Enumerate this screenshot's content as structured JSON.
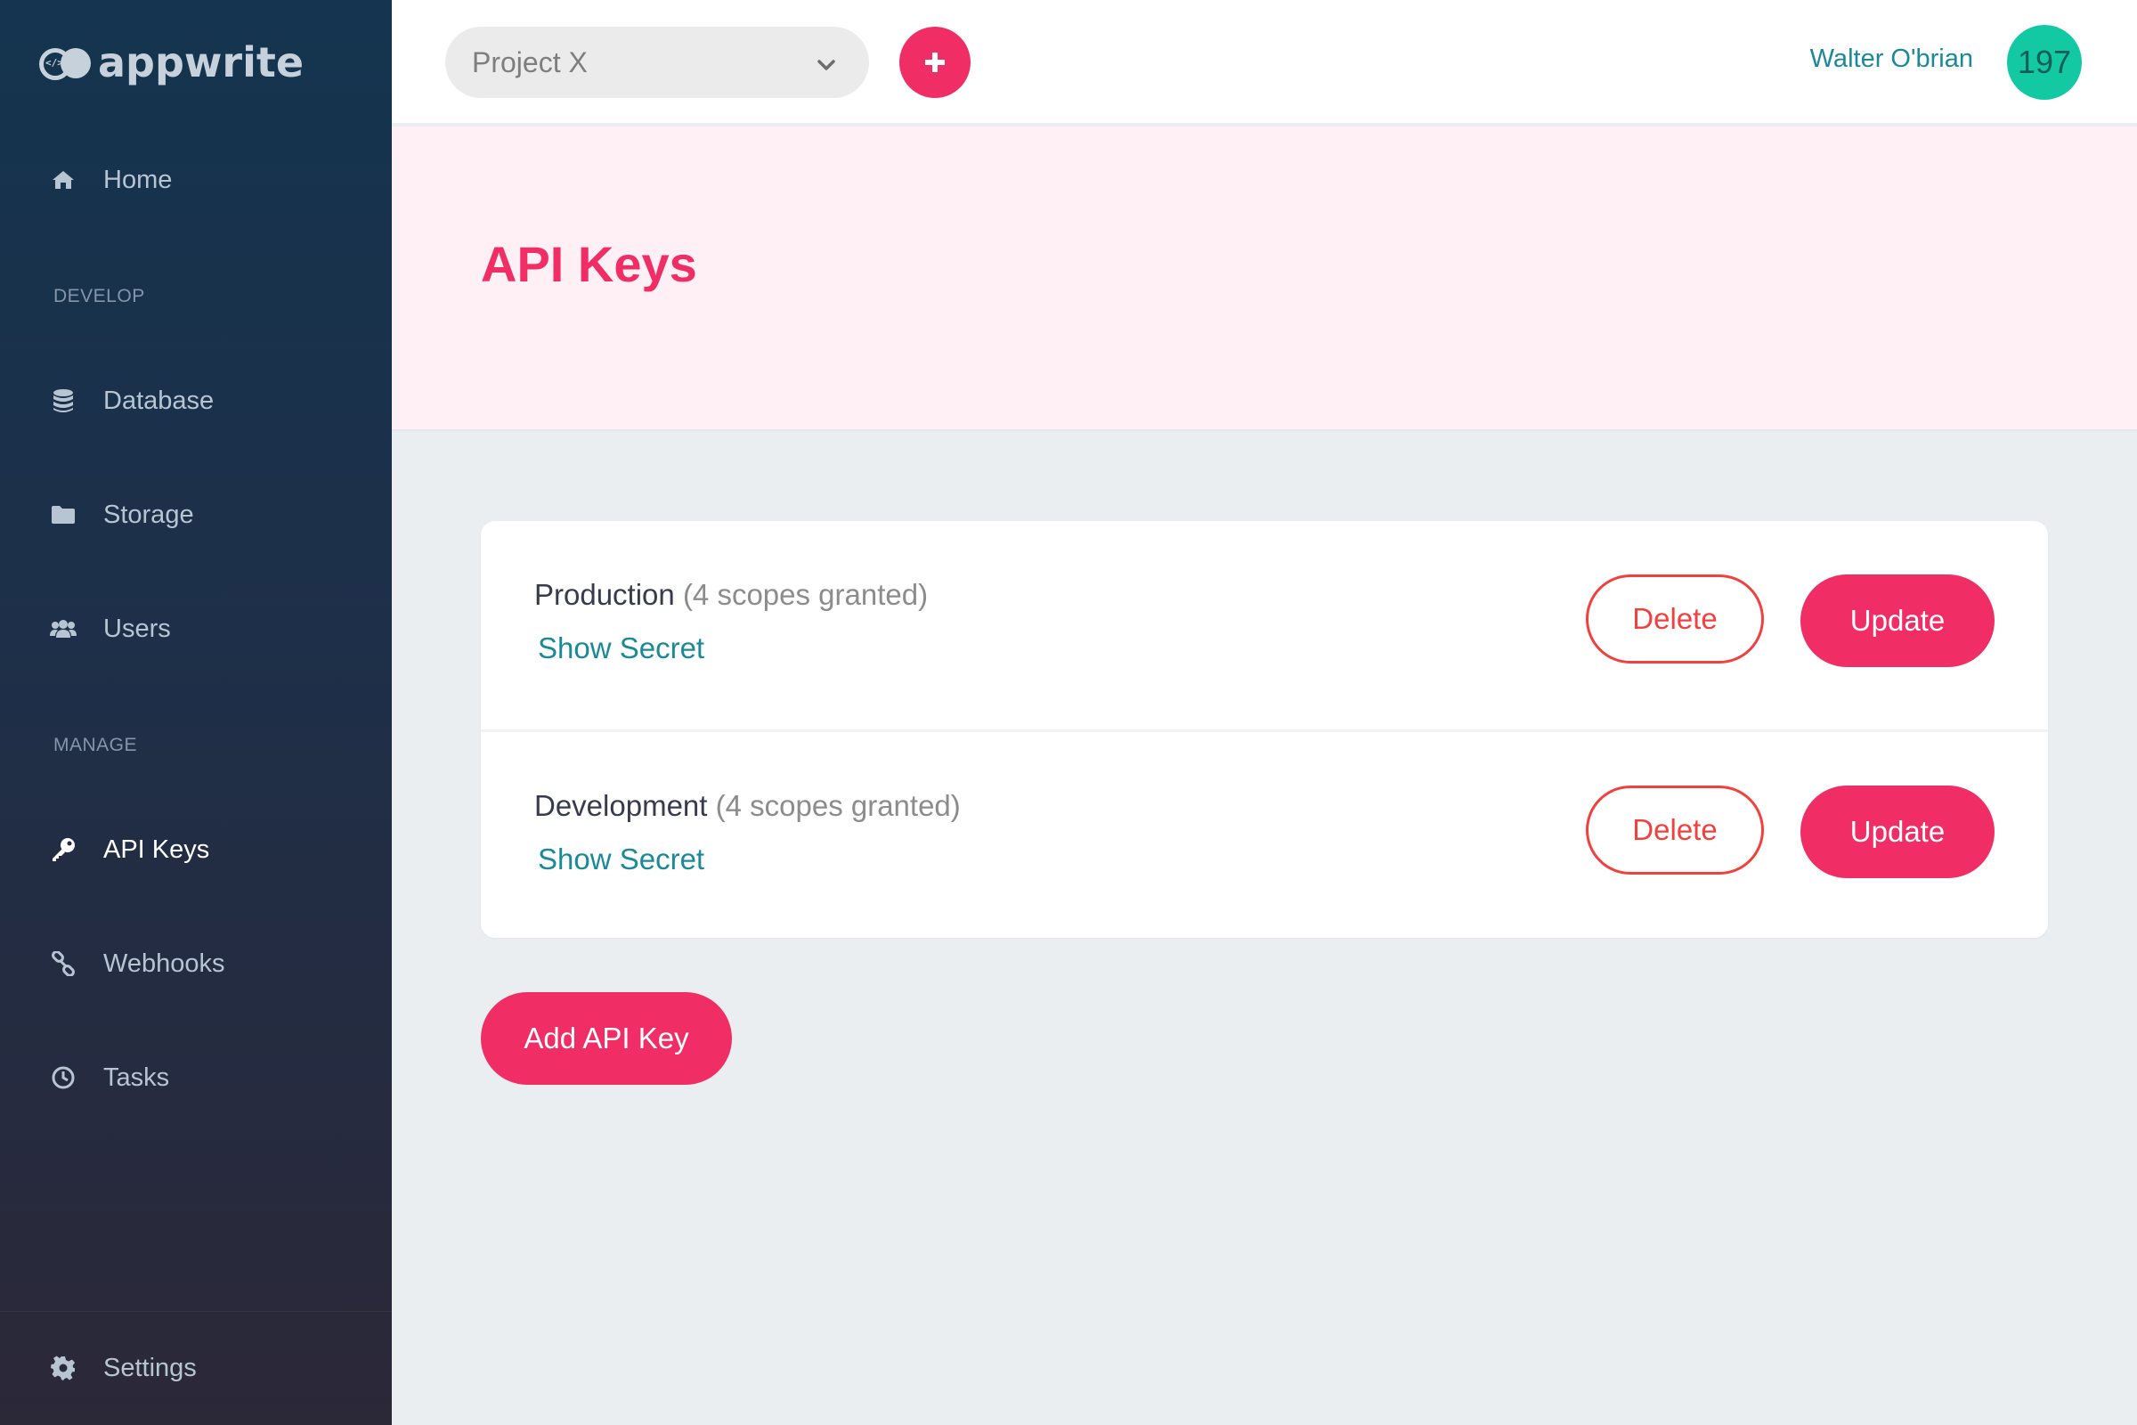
{
  "app": {
    "logo_text": "appwrite"
  },
  "sidebar": {
    "home": {
      "label": "Home",
      "icon": "home-icon"
    },
    "sections": {
      "develop": "DEVELOP",
      "manage": "MANAGE"
    },
    "develop_items": [
      {
        "label": "Database",
        "icon": "database-icon"
      },
      {
        "label": "Storage",
        "icon": "folder-icon"
      },
      {
        "label": "Users",
        "icon": "users-icon"
      }
    ],
    "manage_items": [
      {
        "label": "API Keys",
        "icon": "key-icon",
        "active": true
      },
      {
        "label": "Webhooks",
        "icon": "link-icon"
      },
      {
        "label": "Tasks",
        "icon": "clock-icon"
      }
    ],
    "settings": {
      "label": "Settings",
      "icon": "gear-icon"
    }
  },
  "header": {
    "project_select": {
      "value": "Project X"
    },
    "user_name": "Walter O'brian",
    "avatar_text": "197"
  },
  "page": {
    "title": "API Keys"
  },
  "api_keys": [
    {
      "name": "Production",
      "scopes": "(4 scopes granted)",
      "show_secret": "Show Secret",
      "delete_label": "Delete",
      "update_label": "Update"
    },
    {
      "name": "Development",
      "scopes": "(4 scopes granted)",
      "show_secret": "Show Secret",
      "delete_label": "Delete",
      "update_label": "Update"
    }
  ],
  "actions": {
    "add_key_label": "Add API Key"
  },
  "colors": {
    "accent": "#f02e65",
    "teal": "#1b8a98",
    "avatar_bg": "#12c9a4",
    "danger": "#f0413f",
    "banner_bg": "#fef0f4"
  }
}
